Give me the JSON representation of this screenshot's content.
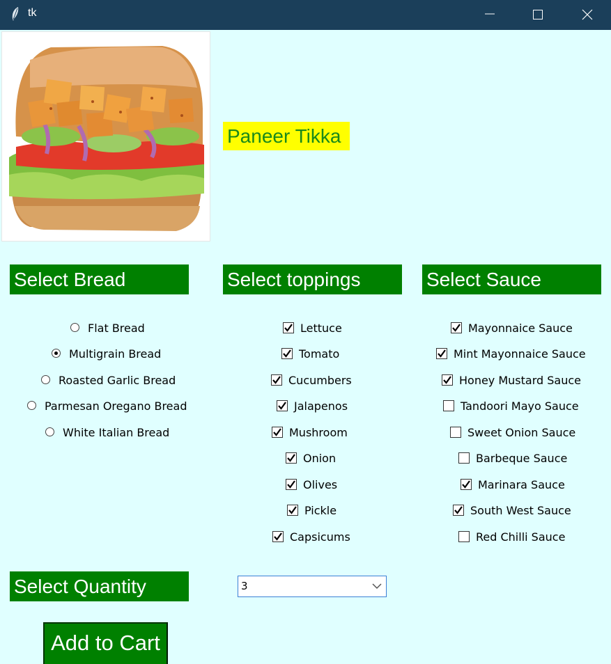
{
  "window": {
    "title": "tk"
  },
  "product": {
    "name": "Paneer Tikka"
  },
  "bread": {
    "header": "Select Bread",
    "options": [
      {
        "label": "Flat Bread",
        "selected": false
      },
      {
        "label": "Multigrain Bread",
        "selected": true
      },
      {
        "label": "Roasted Garlic Bread",
        "selected": false
      },
      {
        "label": "Parmesan Oregano Bread",
        "selected": false
      },
      {
        "label": "White Italian Bread",
        "selected": false
      }
    ]
  },
  "toppings": {
    "header": "Select toppings",
    "options": [
      {
        "label": "Lettuce",
        "checked": true
      },
      {
        "label": "Tomato",
        "checked": true
      },
      {
        "label": "Cucumbers",
        "checked": true
      },
      {
        "label": "Jalapenos",
        "checked": true
      },
      {
        "label": "Mushroom",
        "checked": true
      },
      {
        "label": "Onion",
        "checked": true
      },
      {
        "label": "Olives",
        "checked": true
      },
      {
        "label": "Pickle",
        "checked": true
      },
      {
        "label": "Capsicums",
        "checked": true
      }
    ]
  },
  "sauce": {
    "header": "Select Sauce",
    "options": [
      {
        "label": "Mayonnaice Sauce",
        "checked": true
      },
      {
        "label": "Mint Mayonnaice Sauce",
        "checked": true
      },
      {
        "label": "Honey Mustard Sauce",
        "checked": true
      },
      {
        "label": "Tandoori Mayo Sauce",
        "checked": false
      },
      {
        "label": "Sweet Onion Sauce",
        "checked": false
      },
      {
        "label": "Barbeque Sauce",
        "checked": false
      },
      {
        "label": "Marinara Sauce",
        "checked": true
      },
      {
        "label": "South West Sauce",
        "checked": true
      },
      {
        "label": "Red Chilli Sauce",
        "checked": false
      }
    ]
  },
  "quantity": {
    "header": "Select Quantity",
    "value": "3"
  },
  "actions": {
    "add_to_cart": "Add to Cart"
  },
  "colors": {
    "background": "#e0ffff",
    "header_bg": "#008000",
    "title_bar": "#1b3f5a",
    "product_label_bg": "#ffff00",
    "product_label_text": "#1a8a1a"
  }
}
